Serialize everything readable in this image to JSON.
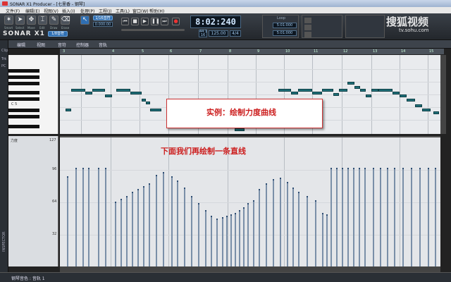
{
  "title_bar": {
    "text": "SONAR X1 Producer - [七里香 - 钢琴]"
  },
  "menu": [
    "文件(F)",
    "编辑(E)",
    "视图(V)",
    "插入(I)",
    "处理(P)",
    "工程(J)",
    "工具(L)",
    "窗口(W)",
    "帮助(H)"
  ],
  "toolbar": {
    "tools": [
      {
        "icon": "smart-tool-icon",
        "label": "Smart"
      },
      {
        "icon": "select-tool-icon",
        "label": "Select"
      },
      {
        "icon": "move-tool-icon",
        "label": "Move"
      },
      {
        "icon": "edit-tool-icon",
        "label": "Edit"
      },
      {
        "icon": "draw-tool-icon",
        "label": "Draw"
      },
      {
        "icon": "erase-tool-icon",
        "label": "Erase"
      }
    ],
    "logo": "SONAR X1",
    "snap_label": "1/8音符",
    "snap_value1": "1/16音符",
    "snap_value2": "0:000:00",
    "time_display": "8:02:240",
    "time_sub1": "44.1",
    "time_sub2": "16",
    "tempo": "125.00",
    "meter": "4/4",
    "loop_label": "Loop",
    "loop_start": "5:01:000",
    "loop_end": "5:01:000"
  },
  "subbar": {
    "items": [
      "编辑",
      "视图",
      "音符",
      "控制器",
      "音轨"
    ]
  },
  "left_labels": [
    "Clip",
    "Trk",
    "PC",
    "INSPECTOR"
  ],
  "ruler": {
    "markers": [
      "3",
      "4",
      "5",
      "6",
      "7",
      "8",
      "9",
      "10",
      "11",
      "12",
      "13",
      "14",
      "15"
    ]
  },
  "piano": {
    "c_label": "C 5"
  },
  "controller": {
    "label": "力度",
    "max": "127",
    "v96": "96",
    "v64": "64",
    "v32": "32"
  },
  "status_bar": {
    "track": "钢琴音色 : 音轨 1"
  },
  "overlay": {
    "caption": "实例：绘制力度曲线",
    "subtitle": "下面我们再绘制一条直线"
  },
  "watermark": {
    "brand": "搜狐视频",
    "site": "tv.sohu.com"
  },
  "colors": {
    "note": "#1f6f78",
    "velocity_bar": "#2e4d72",
    "caption_text": "#cc1e1e"
  }
}
